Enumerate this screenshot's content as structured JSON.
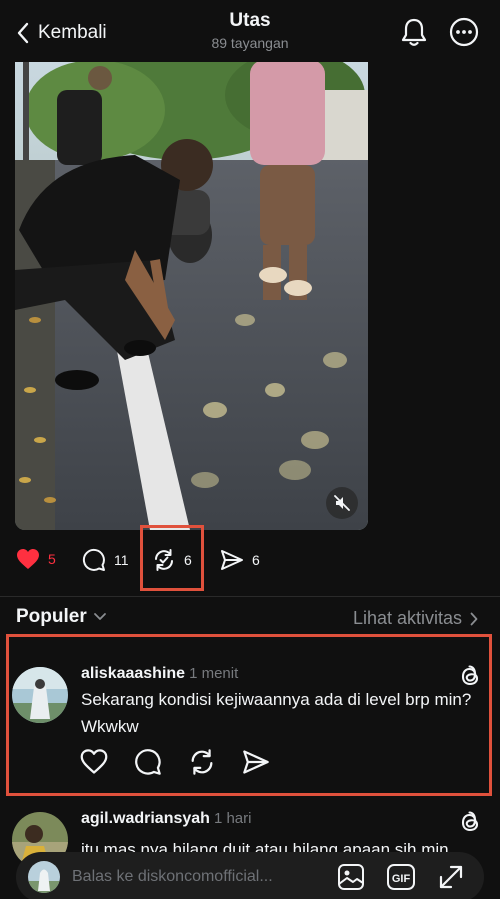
{
  "header": {
    "back_label": "Kembali",
    "title": "Utas",
    "subtitle": "89 tayangan"
  },
  "post": {
    "likes": "5",
    "replies": "11",
    "reposts": "6",
    "shares": "6"
  },
  "section": {
    "sort_label": "Populer",
    "activity_label": "Lihat aktivitas"
  },
  "comments": [
    {
      "username": "aliskaaashine",
      "time": "1 menit",
      "text": "Sekarang kondisi kejiwaannya ada di level brp min? Wkwkw"
    },
    {
      "username": "agil.wadriansyah",
      "time": "1 hari",
      "text": "itu mas nya hilang duit atau hilang apaan sih min"
    }
  ],
  "reply_bar": {
    "placeholder": "Balas ke diskoncomofficial..."
  },
  "colors": {
    "background": "#101010",
    "like_red": "#ff3040",
    "highlight_box": "#e0513c",
    "muted_text": "#8a8d91"
  },
  "icons": [
    "chevron-left-icon",
    "bell-icon",
    "more-icon",
    "mute-icon",
    "heart-icon",
    "comment-icon",
    "repost-icon",
    "share-icon",
    "chevron-down-icon",
    "chevron-right-icon",
    "threads-icon",
    "image-icon",
    "gif-icon",
    "expand-icon"
  ]
}
